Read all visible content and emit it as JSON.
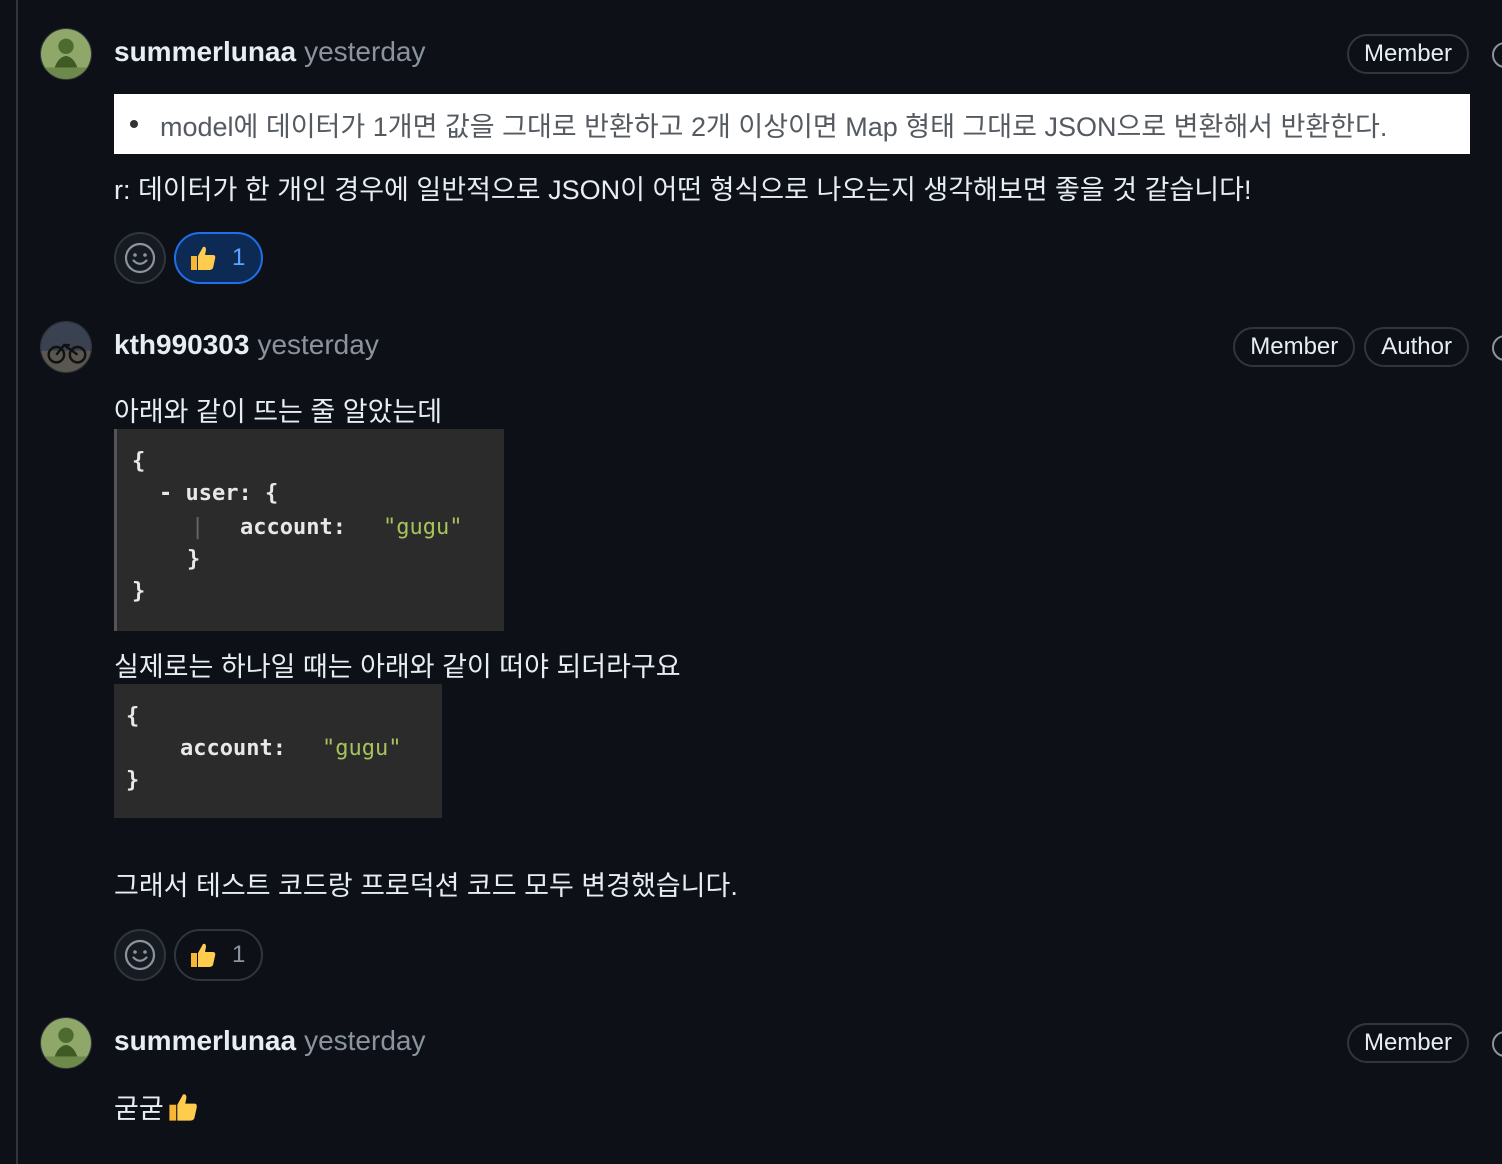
{
  "colors": {
    "background": "#0d1117",
    "text": "#e6edf3",
    "muted": "#8b949e",
    "border": "#30363d",
    "active_reaction_border": "#1f6feb",
    "active_reaction_text": "#58a6ff",
    "code_string": "#a9c25d"
  },
  "comments": [
    {
      "author": "summerlunaa",
      "time": "yesterday",
      "badges": [
        "Member"
      ],
      "quote_image_text": "model에 데이터가 1개면 값을 그대로 반환하고 2개 이상이면 Map 형태 그대로 JSON으로 변환해서 반환한다.",
      "text": "r: 데이터가 한 개인 경우에 일반적으로 JSON이 어떤 형식으로 나오는지 생각해보면 좋을 것 같습니다!",
      "reaction": {
        "emoji": "thumbs-up-icon",
        "count": "1",
        "active": true
      }
    },
    {
      "author": "kth990303",
      "time": "yesterday",
      "badges": [
        "Member",
        "Author"
      ],
      "text_1": "아래와 같이 뜨는 줄 알았는데",
      "code_1": {
        "open": "{",
        "user_line": "- user: {",
        "account_key": "account:",
        "account_value": "\"gugu\"",
        "inner_close": "}",
        "close": "}"
      },
      "text_2": "실제로는 하나일 때는 아래와 같이 떠야 되더라구요",
      "code_2": {
        "open": "{",
        "account_key": "account:",
        "account_value": "\"gugu\"",
        "close": "}"
      },
      "text_3": "그래서 테스트 코드랑 프로덕션 코드 모두 변경했습니다.",
      "reaction": {
        "emoji": "thumbs-up-icon",
        "count": "1",
        "active": false
      }
    },
    {
      "author": "summerlunaa",
      "time": "yesterday",
      "badges": [
        "Member"
      ],
      "text": "굳굳"
    }
  ]
}
